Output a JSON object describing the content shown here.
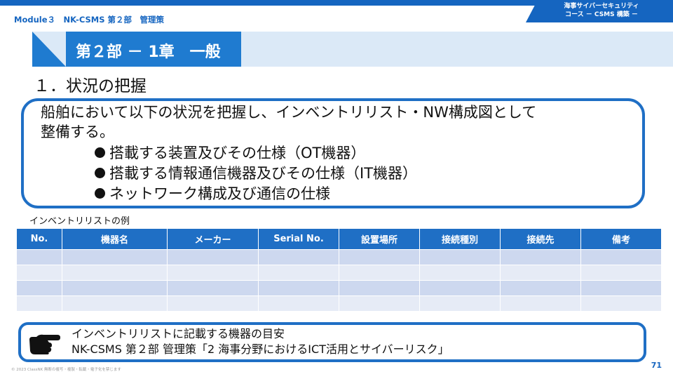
{
  "header": {
    "module": "Module３　NK-CSMS 第２部　管理策",
    "corner_line1": "海事サイバーセキュリティ",
    "corner_line2": "コース － CSMS 構築 －"
  },
  "chapter": {
    "title": "第２部 － 1章　一般"
  },
  "section": {
    "title": "１．状況の把握"
  },
  "main_box": {
    "line1": "船舶において以下の状況を把握し、インベントリリスト・NW構成図として",
    "line2": "整備する。",
    "bullets": [
      "搭載する装置及びその仕様（OT機器）",
      "搭載する情報通信機器及びその仕様（IT機器）",
      "ネットワーク構成及び通信の仕様"
    ]
  },
  "table": {
    "caption": "インベントリリストの例",
    "headers": [
      "No.",
      "機器名",
      "メーカー",
      "Serial No.",
      "設置場所",
      "接続種別",
      "接続先",
      "備考"
    ],
    "rows": [
      [
        "",
        "",
        "",
        "",
        "",
        "",
        "",
        ""
      ],
      [
        "",
        "",
        "",
        "",
        "",
        "",
        "",
        ""
      ],
      [
        "",
        "",
        "",
        "",
        "",
        "",
        "",
        ""
      ],
      [
        "",
        "",
        "",
        "",
        "",
        "",
        "",
        ""
      ]
    ]
  },
  "reference": {
    "icon": "pointing-hand-icon",
    "line1": "インベントリリストに記載する機器の目安",
    "line2": "NK-CSMS 第２部 管理策「2 海事分野におけるICT活用とサイバーリスク」"
  },
  "footer": {
    "copyright": "© 2023 ClassNK 無断の複写・複製・転載・電子化を禁じます",
    "page": "71"
  },
  "colors": {
    "accent": "#1f6fc5",
    "header_blue": "#1565c0",
    "band": "#dbe9f7",
    "row_odd": "#cdd8ef",
    "row_even": "#e6ebf6"
  }
}
